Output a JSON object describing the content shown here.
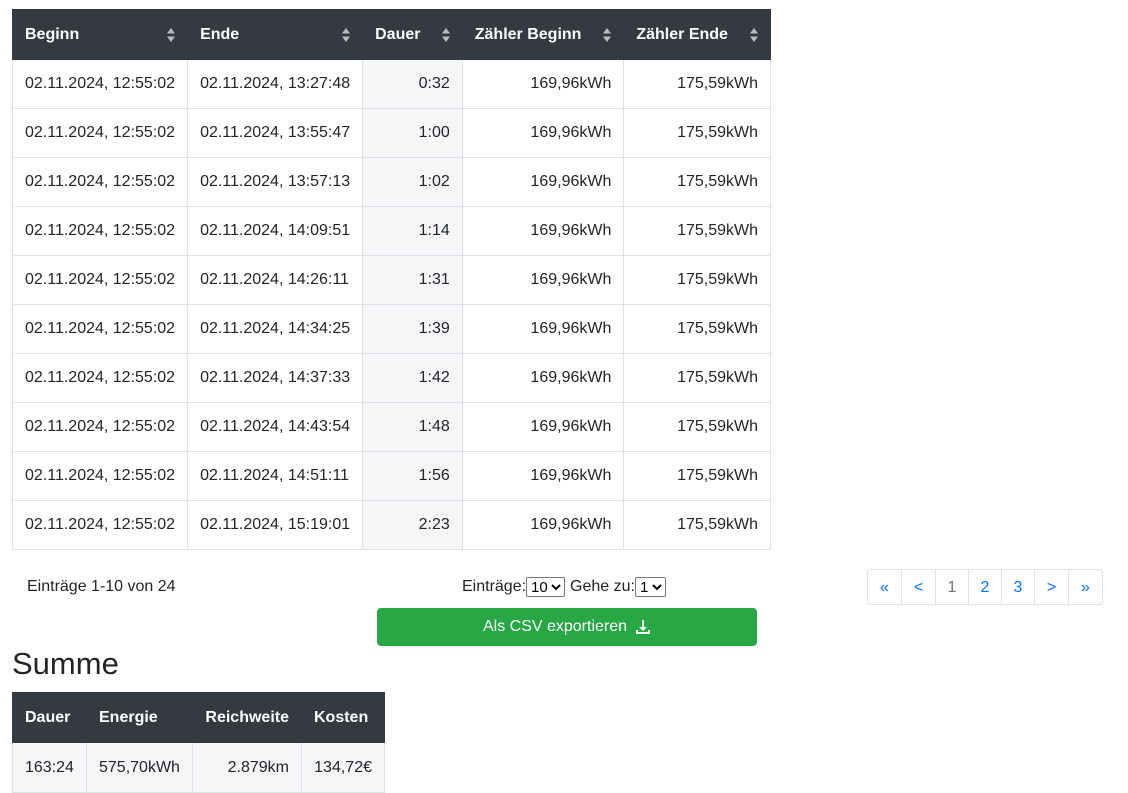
{
  "table": {
    "headers": [
      "Beginn",
      "Ende",
      "Dauer",
      "Zähler Beginn",
      "Zähler Ende"
    ],
    "rows": [
      [
        "02.11.2024, 12:55:02",
        "02.11.2024, 13:27:48",
        "0:32",
        "169,96kWh",
        "175,59kWh"
      ],
      [
        "02.11.2024, 12:55:02",
        "02.11.2024, 13:55:47",
        "1:00",
        "169,96kWh",
        "175,59kWh"
      ],
      [
        "02.11.2024, 12:55:02",
        "02.11.2024, 13:57:13",
        "1:02",
        "169,96kWh",
        "175,59kWh"
      ],
      [
        "02.11.2024, 12:55:02",
        "02.11.2024, 14:09:51",
        "1:14",
        "169,96kWh",
        "175,59kWh"
      ],
      [
        "02.11.2024, 12:55:02",
        "02.11.2024, 14:26:11",
        "1:31",
        "169,96kWh",
        "175,59kWh"
      ],
      [
        "02.11.2024, 12:55:02",
        "02.11.2024, 14:34:25",
        "1:39",
        "169,96kWh",
        "175,59kWh"
      ],
      [
        "02.11.2024, 12:55:02",
        "02.11.2024, 14:37:33",
        "1:42",
        "169,96kWh",
        "175,59kWh"
      ],
      [
        "02.11.2024, 12:55:02",
        "02.11.2024, 14:43:54",
        "1:48",
        "169,96kWh",
        "175,59kWh"
      ],
      [
        "02.11.2024, 12:55:02",
        "02.11.2024, 14:51:11",
        "1:56",
        "169,96kWh",
        "175,59kWh"
      ],
      [
        "02.11.2024, 12:55:02",
        "02.11.2024, 15:19:01",
        "2:23",
        "169,96kWh",
        "175,59kWh"
      ]
    ]
  },
  "footer": {
    "entries_info": "Einträge 1-10 von 24",
    "entries_label": "Einträge:",
    "entries_value": "10",
    "goto_label": "Gehe zu:",
    "goto_value": "1"
  },
  "pagination": {
    "first": "«",
    "prev": "<",
    "pages": [
      "1",
      "2",
      "3"
    ],
    "next": ">",
    "last": "»",
    "current": "1"
  },
  "export": {
    "label": "Als CSV exportieren",
    "icon": "download-icon"
  },
  "summary": {
    "title": "Summe",
    "headers": [
      "Dauer",
      "Energie",
      "Reichweite",
      "Kosten"
    ],
    "values": [
      "163:24",
      "575,70kWh",
      "2.879km",
      "134,72€"
    ]
  },
  "colors": {
    "header_bg": "#343a40",
    "button": "#28a745",
    "link": "#0d6efd"
  }
}
